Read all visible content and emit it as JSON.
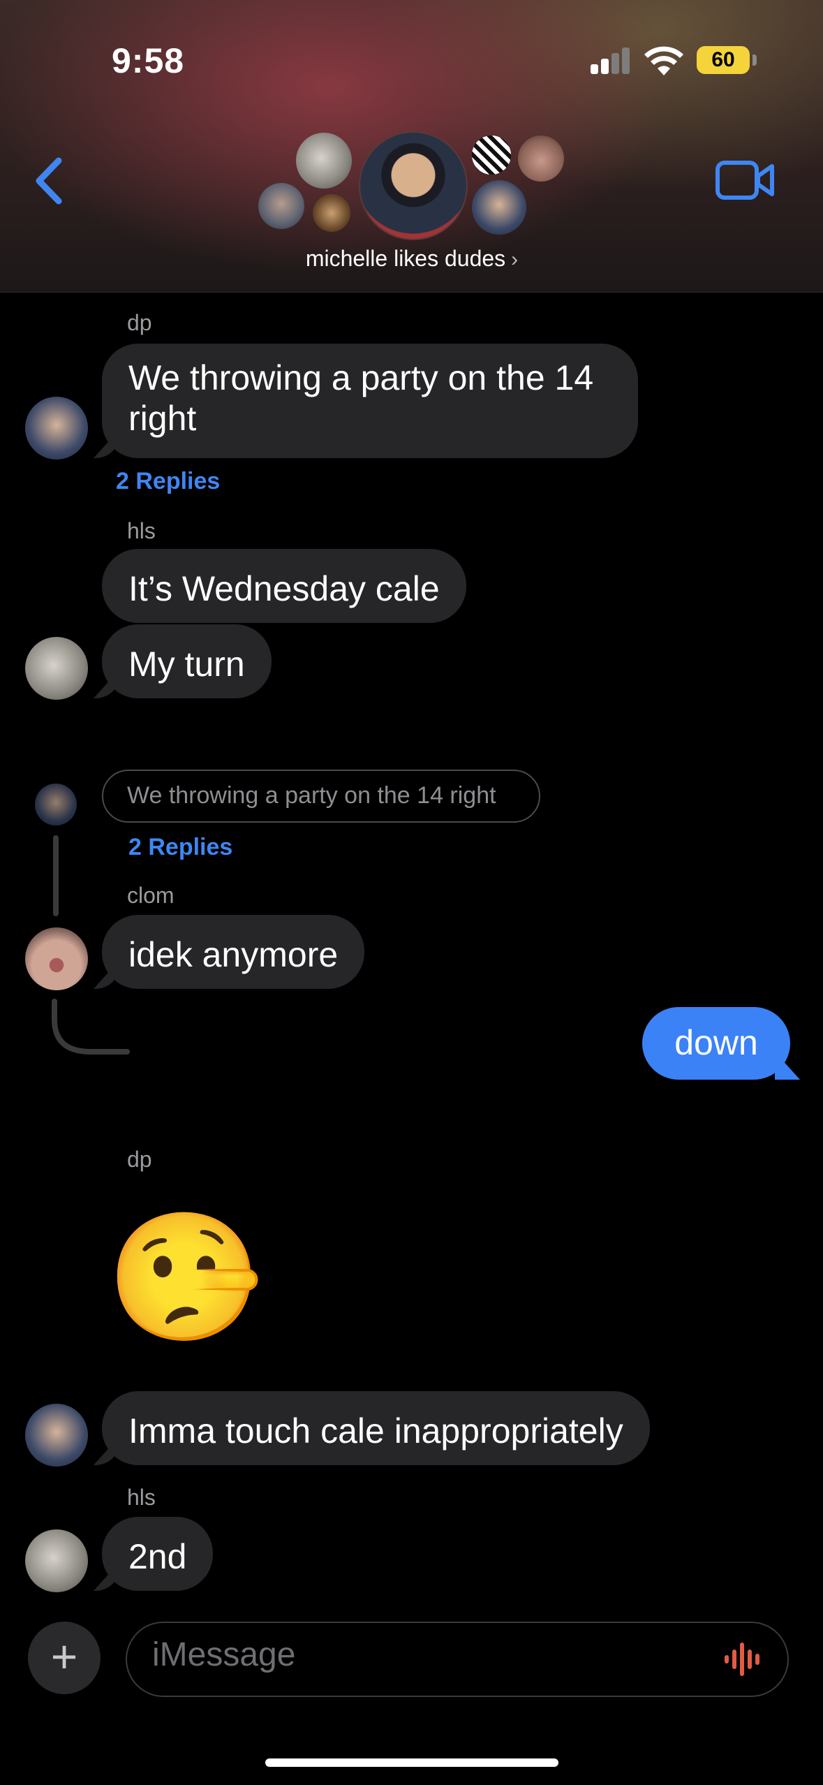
{
  "status_bar": {
    "time": "9:58",
    "battery": "60"
  },
  "header": {
    "group_name": "michelle likes dudes",
    "chevron": "›"
  },
  "messages": [
    {
      "sender": "dp",
      "text": "We throwing a party on the 14 right",
      "replies": "2 Replies"
    },
    {
      "sender": "hls",
      "text1": "It’s Wednesday cale",
      "text2": "My turn"
    },
    {
      "quote": "We throwing a party on the 14 right",
      "replies": "2 Replies",
      "sender": "clom",
      "text": "idek anymore"
    },
    {
      "outgoing": "down"
    },
    {
      "sender": "dp",
      "emoji": "🤥",
      "text": "Imma touch cale inappropriately"
    },
    {
      "sender": "hls",
      "text": "2nd"
    }
  ],
  "composer": {
    "placeholder": "iMessage",
    "plus": "+"
  },
  "colors": {
    "accent": "#3b82f6",
    "incoming_bubble": "#262629",
    "link": "#3f86f2"
  }
}
